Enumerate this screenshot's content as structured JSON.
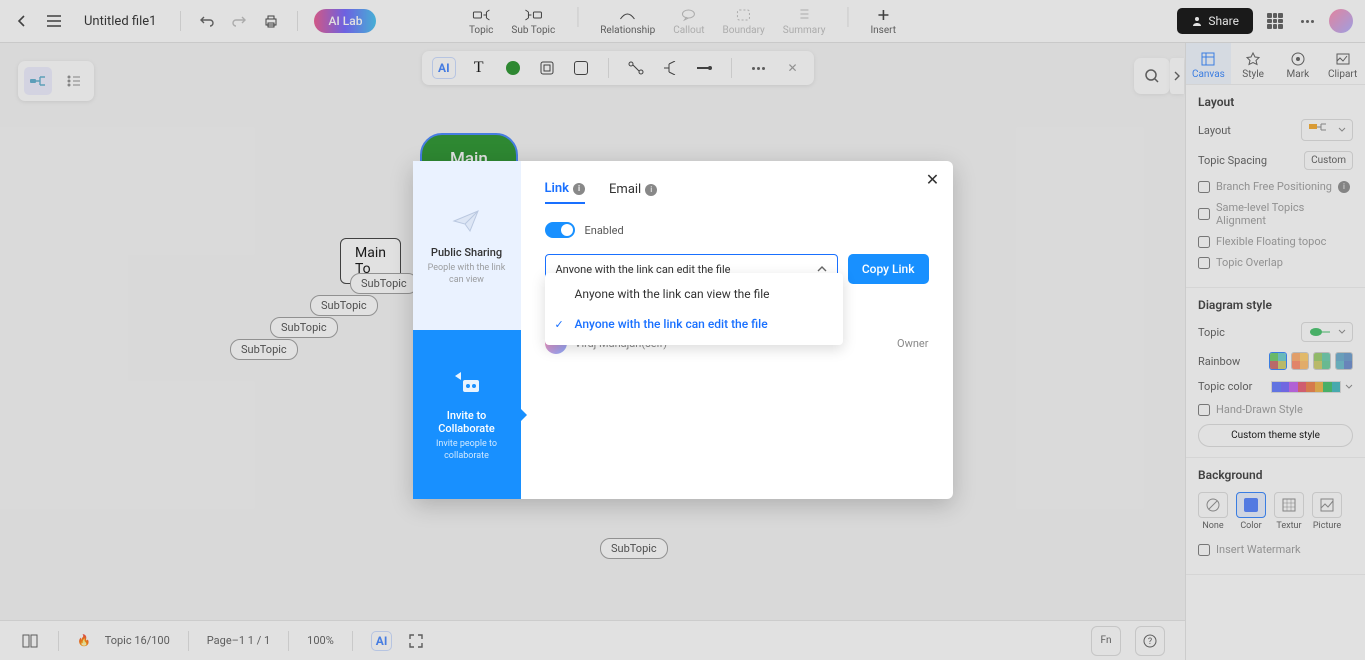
{
  "header": {
    "doc_title": "Untitled file1",
    "ai_lab": "AI Lab",
    "share": "Share",
    "center_tools": [
      {
        "label": "Topic",
        "disabled": false
      },
      {
        "label": "Sub Topic",
        "disabled": false
      },
      {
        "label": "Relationship",
        "disabled": false
      },
      {
        "label": "Callout",
        "disabled": true
      },
      {
        "label": "Boundary",
        "disabled": true
      },
      {
        "label": "Summary",
        "disabled": true
      },
      {
        "label": "Insert",
        "disabled": false
      }
    ]
  },
  "floating_toolbar": {
    "ai": "AI"
  },
  "mindmap": {
    "main": "Main Idea",
    "main_topic": "Main To",
    "subtopics": [
      "SubTopic",
      "SubTopic",
      "SubTopic",
      "SubTopic",
      "SubTopic"
    ]
  },
  "right_tabs": [
    "Canvas",
    "Style",
    "Mark",
    "Clipart"
  ],
  "layout": {
    "title": "Layout",
    "layout_label": "Layout",
    "spacing_label": "Topic Spacing",
    "spacing_value": "Custom",
    "checks": [
      "Branch Free Positioning",
      "Same-level Topics Alignment",
      "Flexible Floating topoc",
      "Topic Overlap"
    ]
  },
  "diagram": {
    "title": "Diagram style",
    "topic_label": "Topic",
    "rainbow_label": "Rainbow",
    "topic_color_label": "Topic color",
    "hand_drawn": "Hand-Drawn Style",
    "custom_theme": "Custom theme style"
  },
  "background": {
    "title": "Background",
    "opts": [
      "None",
      "Color",
      "Textur",
      "Picture"
    ],
    "watermark": "Insert Watermark"
  },
  "bottom": {
    "topic_count": "Topic 16/100",
    "page": "Page–1  1 / 1",
    "zoom": "100%",
    "ai": "AI"
  },
  "modal": {
    "public": {
      "title": "Public Sharing",
      "desc": "People with the link can view"
    },
    "collab": {
      "title": "Invite to Collaborate",
      "desc": "Invite people to collaborate"
    },
    "tabs": {
      "link": "Link",
      "email": "Email"
    },
    "enabled": "Enabled",
    "select_value": "Anyone with the link can edit the file",
    "copy": "Copy Link",
    "options": [
      "Anyone with the link can view the file",
      "Anyone with the link can edit the file"
    ],
    "user": {
      "name": "Viraj Mahajan(self)",
      "role": "Owner"
    }
  },
  "colors": {
    "topic_strip": [
      "#5b74ff",
      "#6f63ff",
      "#c25cf0",
      "#e8566d",
      "#f07b40",
      "#f0b13f",
      "#3cbf63",
      "#3ab8be"
    ]
  }
}
